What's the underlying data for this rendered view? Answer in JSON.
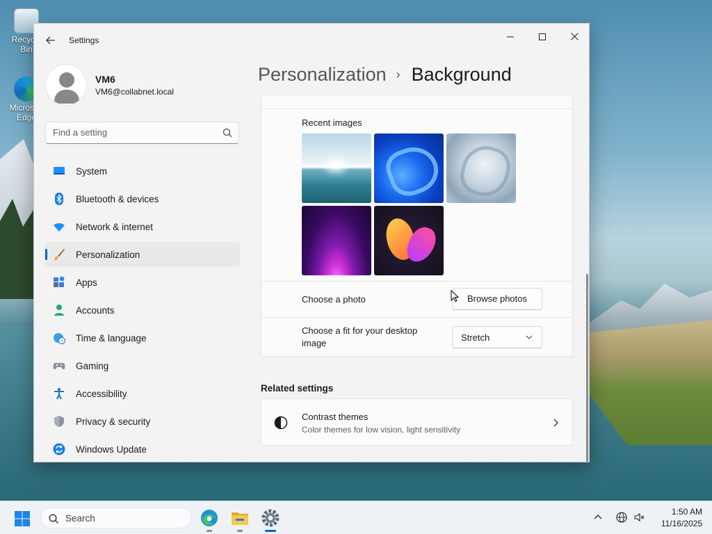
{
  "desktop": {
    "icons": [
      {
        "label": "Recycle Bin",
        "icon": "recycle-bin-icon"
      },
      {
        "label": "Microsoft Edge",
        "icon": "edge-icon"
      }
    ]
  },
  "window": {
    "app_title": "Settings",
    "controls": {
      "minimize": "minimize-icon",
      "maximize": "maximize-icon",
      "close": "close-icon"
    }
  },
  "profile": {
    "name": "VM6",
    "email": "VM6@collabnet.local"
  },
  "search": {
    "placeholder": "Find a setting"
  },
  "sidebar": {
    "items": [
      {
        "label": "System",
        "icon": "system-icon",
        "active": false
      },
      {
        "label": "Bluetooth & devices",
        "icon": "bluetooth-icon",
        "active": false
      },
      {
        "label": "Network & internet",
        "icon": "wifi-icon",
        "active": false
      },
      {
        "label": "Personalization",
        "icon": "brush-icon",
        "active": true
      },
      {
        "label": "Apps",
        "icon": "apps-icon",
        "active": false
      },
      {
        "label": "Accounts",
        "icon": "accounts-icon",
        "active": false
      },
      {
        "label": "Time & language",
        "icon": "globe-clock-icon",
        "active": false
      },
      {
        "label": "Gaming",
        "icon": "gamepad-icon",
        "active": false
      },
      {
        "label": "Accessibility",
        "icon": "accessibility-icon",
        "active": false
      },
      {
        "label": "Privacy & security",
        "icon": "shield-icon",
        "active": false
      },
      {
        "label": "Windows Update",
        "icon": "update-icon",
        "active": false
      }
    ],
    "accent_color": "#0067c0"
  },
  "header": {
    "parent": "Personalization",
    "current": "Background"
  },
  "background": {
    "recent_images_label": "Recent images",
    "recent_images": [
      {
        "name": "lake-sunrise"
      },
      {
        "name": "blue-bloom"
      },
      {
        "name": "silver-bloom"
      },
      {
        "name": "purple-glow"
      },
      {
        "name": "colorful-ribbons"
      }
    ],
    "choose_photo_label": "Choose a photo",
    "browse_button": "Browse photos",
    "fit_label": "Choose a fit for your desktop image",
    "fit_value": "Stretch"
  },
  "related": {
    "title": "Related settings",
    "items": [
      {
        "title": "Contrast themes",
        "description": "Color themes for low vision, light sensitivity"
      }
    ]
  },
  "taskbar": {
    "search_label": "Search",
    "apps": [
      "edge-icon",
      "file-explorer-icon",
      "settings-icon"
    ],
    "time": "1:50 AM",
    "date": "11/16/2025"
  }
}
